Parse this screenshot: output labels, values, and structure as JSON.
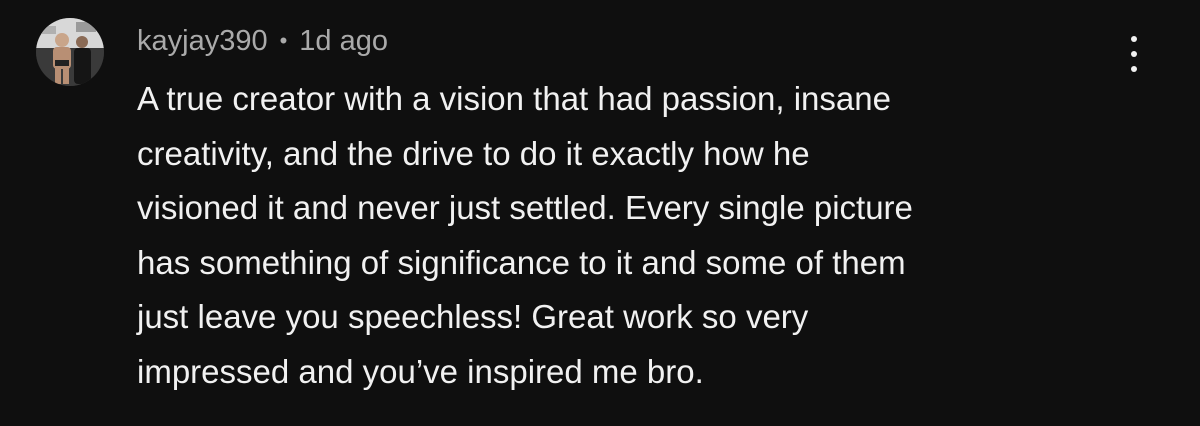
{
  "comment": {
    "author": "kayjay390",
    "separator": "•",
    "timestamp": "1d ago",
    "text": "A true creator with a vision that had passion, insane\ncreativity, and the drive to do it exactly how he\nvisioned it and never just settled. Every single picture\nhas something of significance to it and some of them\njust leave you speechless! Great work so very\nimpressed and you’ve inspired me bro.",
    "menu_icon": "more-vertical-icon"
  },
  "colors": {
    "background": "#0f0f0f",
    "text_primary": "#f1f1f1",
    "text_secondary": "#aaaaaa"
  }
}
